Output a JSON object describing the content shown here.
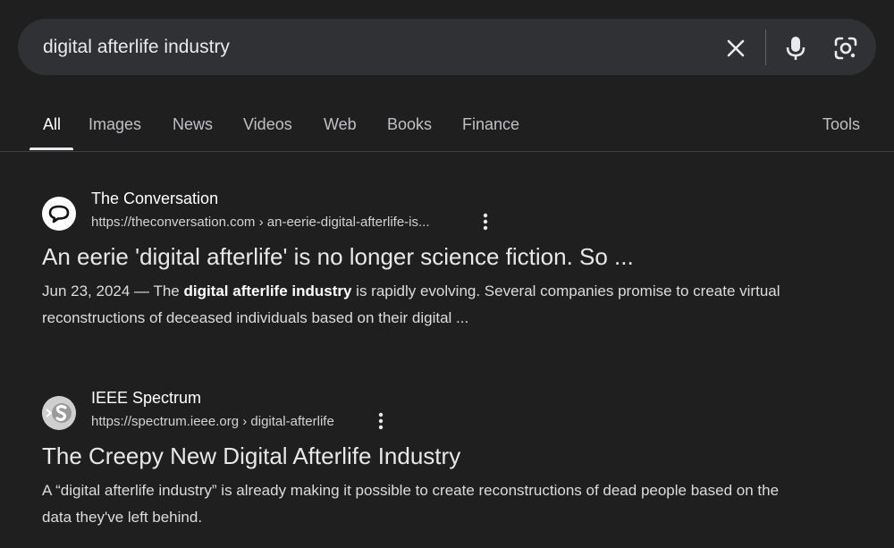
{
  "search": {
    "query": "digital afterlife industry",
    "clear_icon": "close-icon",
    "mic_icon": "microphone-icon",
    "lens_icon": "google-lens-icon"
  },
  "tabs": [
    {
      "label": "All",
      "active": true
    },
    {
      "label": "Images"
    },
    {
      "label": "News"
    },
    {
      "label": "Videos"
    },
    {
      "label": "Web"
    },
    {
      "label": "Books"
    },
    {
      "label": "Finance"
    }
  ],
  "tools_label": "Tools",
  "results": [
    {
      "site_name": "The Conversation",
      "url": "https://theconversation.com › an-eerie-digital-afterlife-is...",
      "title": "An eerie 'digital afterlife' is no longer science fiction. So ...",
      "snippet_date": "Jun 23, 2024 — The ",
      "snippet_bold": "digital afterlife industry",
      "snippet_rest": " is rapidly evolving. Several companies promise to create virtual reconstructions of deceased individuals based on their digital ..."
    },
    {
      "site_name": "IEEE Spectrum",
      "url": "https://spectrum.ieee.org › digital-afterlife",
      "title": "The Creepy New Digital Afterlife Industry",
      "snippet": "A “digital afterlife industry” is already making it possible to create reconstructions of dead people based on the data they've left behind."
    }
  ],
  "colors": {
    "background": "#1f1f1f",
    "searchbar": "#303134",
    "text": "#e8e8e8"
  }
}
